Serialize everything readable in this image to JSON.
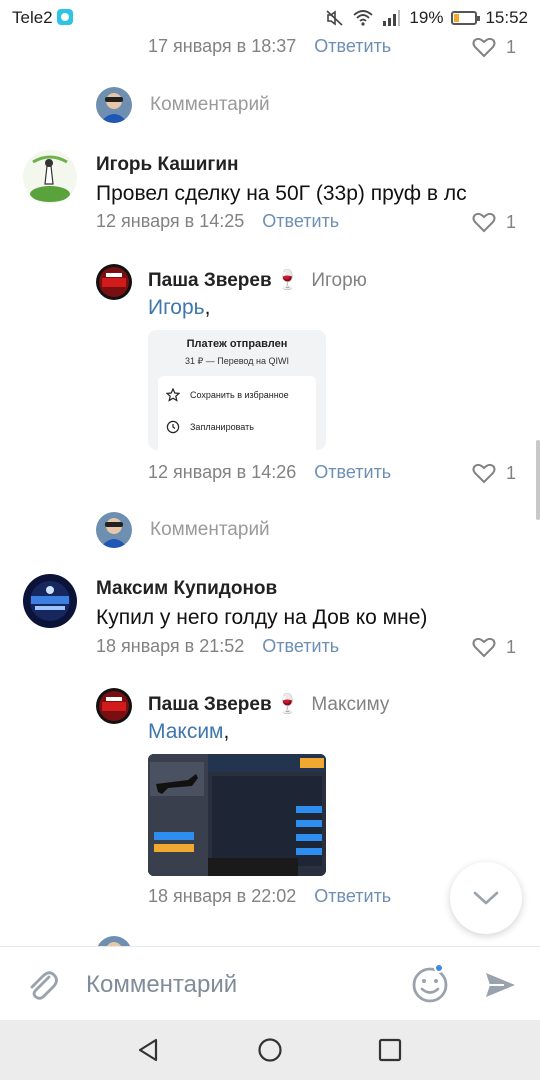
{
  "status_bar": {
    "carrier": "Tele2",
    "battery": "19%",
    "battery_color": "#f0a830",
    "time": "15:52",
    "icons": [
      "mute-icon",
      "wifi-icon",
      "signal-icon",
      "battery-icon"
    ]
  },
  "colors": {
    "reply_link": "#6d8fb3",
    "mention": "#3f77ad",
    "meta_gray": "#828282",
    "accent": "#3f8ae0"
  },
  "comments": {
    "top_meta": {
      "date": "17 января в 18:37",
      "reply": "Ответить",
      "likes": "1"
    },
    "prompt_1": {
      "placeholder": "Комментарий"
    },
    "thread_1": {
      "author": "Игорь Кашигин",
      "text": "Провел сделку на 50Г (33р) пруф в лс",
      "date": "12 января в 14:25",
      "reply": "Ответить",
      "likes": "1"
    },
    "reply_1": {
      "author": "Паша Зверев",
      "emoji": "🍷",
      "to": "Игорю",
      "mention": "Игорь",
      "comma": ",",
      "attachment": {
        "title": "Платеж отправлен",
        "subtitle": "31 ₽ — Перевод на QIWI",
        "row_1": "Сохранить в избранное",
        "row_2": "Запланировать"
      },
      "date": "12 января в 14:26",
      "reply": "Ответить",
      "likes": "1"
    },
    "prompt_2": {
      "placeholder": "Комментарий"
    },
    "thread_2": {
      "author": "Максим Купидонов",
      "text": "Купил у него голду на Дов ко мне)",
      "date": "18 января в 21:52",
      "reply": "Ответить",
      "likes": "1"
    },
    "reply_2": {
      "author": "Паша Зверев",
      "emoji": "🍷",
      "to": "Максиму",
      "mention": "Максим",
      "comma": ",",
      "date": "18 января в 22:02",
      "reply": "Ответить"
    }
  },
  "composer": {
    "placeholder": "Комментарий"
  },
  "nav": [
    "back-icon",
    "home-icon",
    "recents-icon"
  ]
}
